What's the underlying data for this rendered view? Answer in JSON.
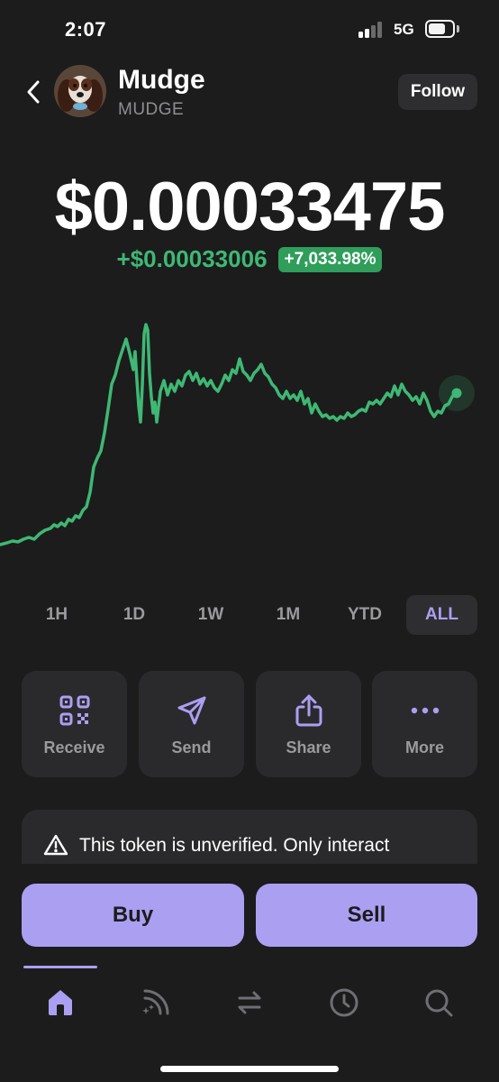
{
  "status_bar": {
    "time": "2:07",
    "network": "5G"
  },
  "header": {
    "token_name": "Mudge",
    "token_symbol": "MUDGE",
    "follow_label": "Follow",
    "icons": {
      "back": "chevron-left-icon",
      "avatar": "dog-avatar"
    }
  },
  "price": {
    "value": "$0.00033475",
    "change_abs": "+$0.00033006",
    "change_pct": "+7,033.98%"
  },
  "colors": {
    "background": "#1c1c1c",
    "accent": "#ab9ff2",
    "positive": "#3eb874",
    "positive_badge": "#2f9e5a",
    "card": "#2a2a2c"
  },
  "ranges": {
    "options": [
      "1H",
      "1D",
      "1W",
      "1M",
      "YTD",
      "ALL"
    ],
    "selected": "ALL"
  },
  "actions": [
    {
      "label": "Receive",
      "icon": "qr-code-icon"
    },
    {
      "label": "Send",
      "icon": "send-icon"
    },
    {
      "label": "Share",
      "icon": "share-icon"
    },
    {
      "label": "More",
      "icon": "more-dots-icon"
    }
  ],
  "warning": {
    "text": "This token is unverified. Only interact",
    "icon": "warning-triangle-icon"
  },
  "trade": {
    "buy_label": "Buy",
    "sell_label": "Sell"
  },
  "bottom_nav": [
    {
      "icon": "home-icon",
      "active": true
    },
    {
      "icon": "explore-feed-icon",
      "active": false
    },
    {
      "icon": "swap-icon",
      "active": false
    },
    {
      "icon": "history-clock-icon",
      "active": false
    },
    {
      "icon": "search-icon",
      "active": false
    }
  ]
}
